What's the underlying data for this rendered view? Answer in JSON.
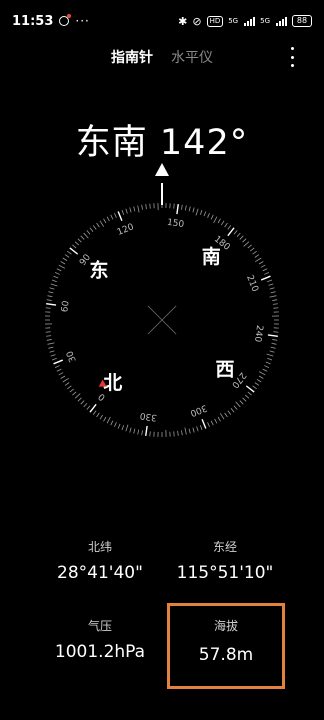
{
  "status_bar": {
    "time": "11:53",
    "more": "···",
    "network_1": "5G",
    "network_2": "5G",
    "hd": "HD",
    "battery": "88"
  },
  "tabs": [
    {
      "label": "指南针",
      "active": true
    },
    {
      "label": "水平仪",
      "active": false
    }
  ],
  "heading": "东南 142°",
  "compass": {
    "heading_deg": 142,
    "cardinals": {
      "N": "北",
      "E": "东",
      "S": "南",
      "W": "西"
    },
    "degree_labels": [
      "0",
      "30",
      "60",
      "90",
      "120",
      "150",
      "180",
      "210",
      "240",
      "270",
      "300",
      "330"
    ],
    "accent_color": "#e53935"
  },
  "info": {
    "latitude": {
      "label": "北纬",
      "value": "28°41'40\""
    },
    "longitude": {
      "label": "东经",
      "value": "115°51'10\""
    },
    "pressure": {
      "label": "气压",
      "value": "1001.2hPa"
    },
    "altitude": {
      "label": "海拔",
      "value": "57.8m"
    }
  },
  "highlight_color": "#e4813d"
}
